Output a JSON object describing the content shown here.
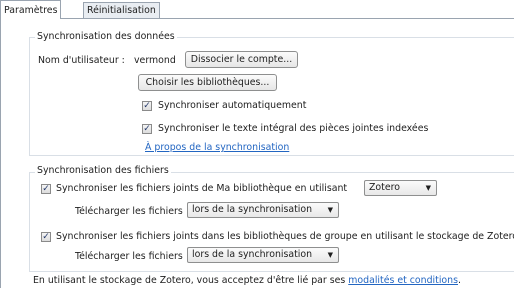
{
  "tabs": [
    "Paramètres",
    "Réinitialisation"
  ],
  "data_sync": {
    "legend": "Synchronisation des données",
    "username_label": "Nom d'utilisateur :",
    "username_value": "vermond",
    "unlink_button": "Dissocier le compte...",
    "choose_libraries_button": "Choisir les bibliothèques...",
    "auto_sync": {
      "label": "Synchroniser automatiquement",
      "checked": true
    },
    "fulltext_sync": {
      "label": "Synchroniser le texte intégral des pièces jointes indexées",
      "checked": true
    },
    "about_link": "À propos de la synchronisation"
  },
  "file_sync": {
    "legend": "Synchronisation des fichiers",
    "my_library": {
      "label": "Synchroniser les fichiers joints de Ma bibliothèque en utilisant",
      "checked": true,
      "storage_value": "Zotero",
      "download_label": "Télécharger les fichiers",
      "download_value": "lors de la synchronisation"
    },
    "group_libraries": {
      "label": "Synchroniser les fichiers joints dans les bibliothèques de groupe en utilisant le stockage de Zotero",
      "checked": true,
      "download_label": "Télécharger les fichiers",
      "download_value": "lors de la synchronisation"
    }
  },
  "terms": {
    "text": "En utilisant le stockage de Zotero, vous acceptez d'être lié par ses ",
    "link": "modalités et conditions",
    "suffix": "."
  }
}
